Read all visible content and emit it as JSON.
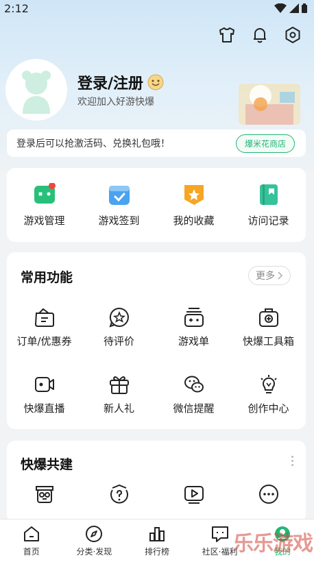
{
  "status": {
    "time": "2:12"
  },
  "header": {
    "login_title": "登录/注册",
    "login_subtitle": "欢迎加入好游快爆",
    "promo_text": "登录后可以抢激活码、兑换礼包哦！",
    "promo_button": "爆米花商店"
  },
  "quick": [
    {
      "label": "游戏管理"
    },
    {
      "label": "游戏签到"
    },
    {
      "label": "我的收藏"
    },
    {
      "label": "访问记录"
    }
  ],
  "common": {
    "title": "常用功能",
    "more": "更多",
    "items": [
      {
        "label": "订单/优惠券"
      },
      {
        "label": "待评价"
      },
      {
        "label": "游戏单"
      },
      {
        "label": "快爆工具箱"
      },
      {
        "label": "快爆直播"
      },
      {
        "label": "新人礼"
      },
      {
        "label": "微信提醒"
      },
      {
        "label": "创作中心"
      }
    ]
  },
  "cobuild": {
    "title": "快爆共建"
  },
  "tabbar": [
    {
      "label": "首页"
    },
    {
      "label": "分类·发现"
    },
    {
      "label": "排行榜"
    },
    {
      "label": "社区·福利"
    },
    {
      "label": "我的"
    }
  ],
  "watermark": "乐乐游戏",
  "colors": {
    "accent": "#20b573",
    "badge": "#f2453d"
  }
}
